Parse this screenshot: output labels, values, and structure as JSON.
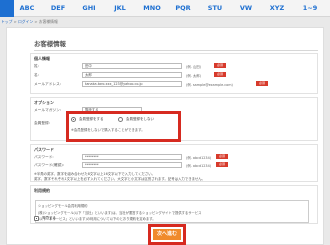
{
  "nav": {
    "tabs": [
      "ABC",
      "DEF",
      "GHI",
      "JKL",
      "MNO",
      "PQR",
      "STU",
      "VW",
      "XYZ",
      "1~9"
    ]
  },
  "breadcrumb": {
    "home": "トップ",
    "mid": "ログイン",
    "current": "お客様情報"
  },
  "page": {
    "title": "お客様情報"
  },
  "personal": {
    "title": "個人情報",
    "rows": [
      {
        "label": "姓:",
        "value": "田中",
        "hint": "(例. 山田)",
        "required": "必須"
      },
      {
        "label": "名:",
        "value": "太郎",
        "hint": "(例. 太郎)",
        "required": "必須"
      },
      {
        "label": "メールアドレス:",
        "value": "tanaka.taro.xxx_123@yahoo.co.jp",
        "hint": "(例. sample@example.com)",
        "required": "必須"
      }
    ]
  },
  "options": {
    "title": "オプション",
    "newsletter_label": "メールマガジン:",
    "newsletter_value": "購読する",
    "register_label": "会員登録:",
    "radio_register": "会員登録をする",
    "radio_no_register": "会員登録をしない",
    "note": "※会員登録をしないで購入することができます。"
  },
  "password": {
    "title": "パスワード",
    "rows": [
      {
        "label": "パスワード:",
        "value": "********",
        "hint": "(例. abcd1234)",
        "required": "必須"
      },
      {
        "label": "パスワード(確認):",
        "value": "********",
        "hint": "(例. abcd1234)",
        "required": "必須"
      }
    ],
    "note1": "※半角の英字、数字を組み合わせた8文字以上16文字以下で入力してください。",
    "note2": "英字、数字それぞれ1文字以上を必ず入れてください。大文字と小文字は区別されます。記号は入力できません。"
  },
  "terms": {
    "title": "利用規約",
    "line1": "ショッピングモール会員利用規約",
    "line2": "(株)ショッピングモール(以下「当社」といいます)は、当社が運営するショッピングサイトで提供するサービス",
    "line3": "(以下「本サービス」といいます)の利用について以下のとおり規約を定めます。",
    "agree": "同意する"
  },
  "actions": {
    "next": "次へ進む"
  },
  "colors": {
    "accent": "#1d6fd1",
    "required": "#d73a2b",
    "highlight": "#d62a20",
    "next_button": "#f08a2c"
  }
}
